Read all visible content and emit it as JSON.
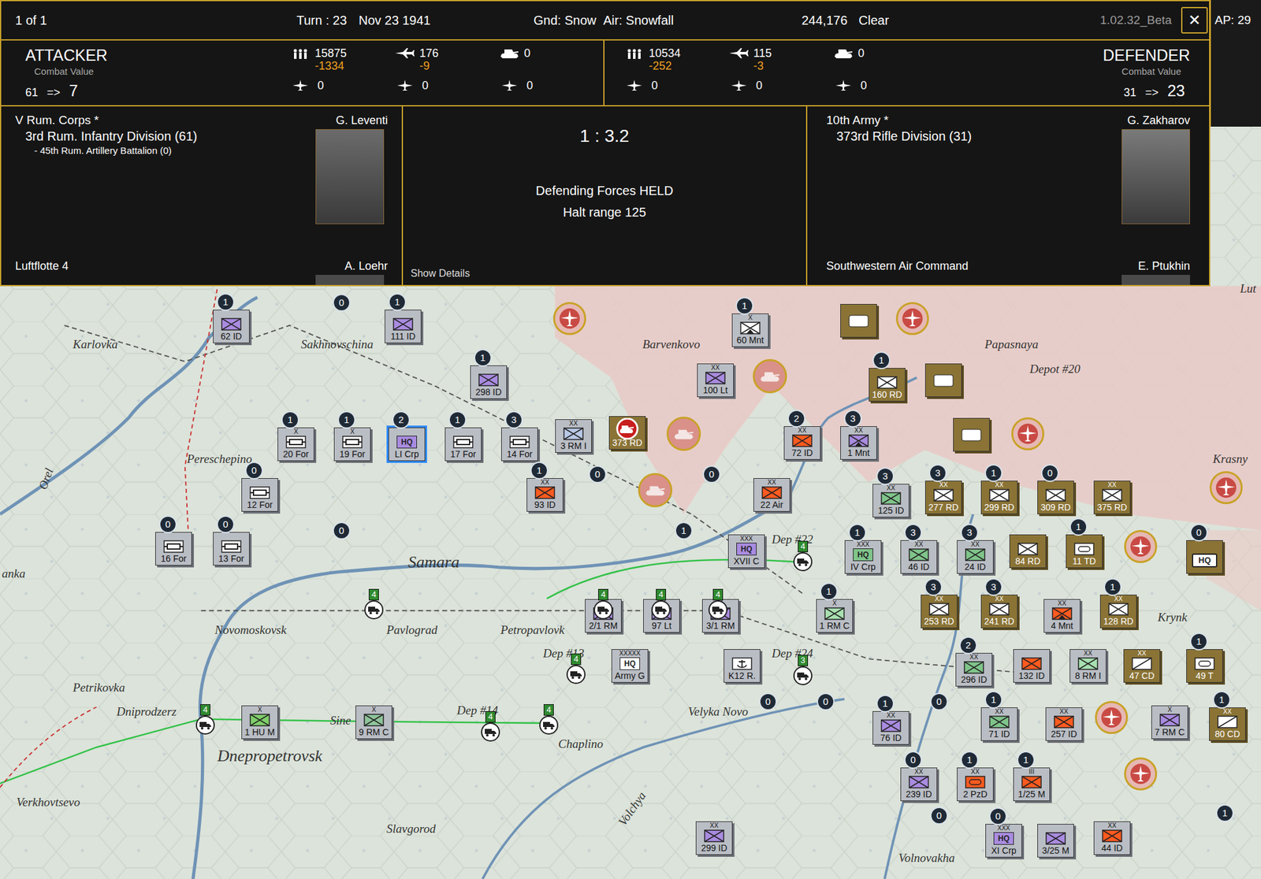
{
  "topbar": {
    "page": "1 of 1",
    "turn": "Turn : 23",
    "date": "Nov 23 1941",
    "ground": "Gnd: Snow",
    "air": "Air: Snowfall",
    "score": "244,176",
    "weather": "Clear",
    "version": "1.02.32_Beta",
    "close": "✕",
    "ap": "AP: 29"
  },
  "attacker": {
    "title": "ATTACKER",
    "cv_label": "Combat Value",
    "cv_from": "61",
    "arrow": "=>",
    "cv_to": "7",
    "men": "15875",
    "men_loss": "-1334",
    "planes": "176",
    "planes_loss": "-9",
    "tanks": "0",
    "row2": [
      "0",
      "0",
      "0"
    ],
    "hq": "V Rum. Corps *",
    "leader": "G. Leventi",
    "units": [
      {
        "text": "3rd Rum. Infantry Division (61)"
      },
      {
        "text": "- 45th Rum. Artillery Battalion (0)"
      }
    ],
    "air_hq": "Luftflotte 4",
    "air_leader": "A. Loehr"
  },
  "defender": {
    "title": "DEFENDER",
    "cv_label": "Combat Value",
    "cv_from": "31",
    "arrow": "=>",
    "cv_to": "23",
    "men": "10534",
    "men_loss": "-252",
    "planes": "115",
    "planes_loss": "-3",
    "tanks": "0",
    "row2": [
      "0",
      "0",
      "0"
    ],
    "hq": "10th Army *",
    "leader": "G. Zakharov",
    "units": [
      {
        "text": "373rd Rifle Division (31)"
      }
    ],
    "air_hq": "Southwestern Air Command",
    "air_leader": "E. Ptukhin"
  },
  "result": {
    "odds": "1 : 3.2",
    "outcome": "Defending Forces HELD",
    "halt": "Halt range 125",
    "details": "Show Details"
  },
  "map": {
    "labels": [
      {
        "text": "Karlovka"
      },
      {
        "text": "Sakhnovschina"
      },
      {
        "text": "Barvenkovo"
      },
      {
        "text": "Papasnaya"
      },
      {
        "text": "Depot #20"
      },
      {
        "text": "Krasny"
      },
      {
        "text": "Pereschepino"
      },
      {
        "text": "Samara"
      },
      {
        "text": "Novomoskovsk"
      },
      {
        "text": "Pavlograd"
      },
      {
        "text": "Petropavlovk"
      },
      {
        "text": "Petrikovka"
      },
      {
        "text": "Dniprodzerz"
      },
      {
        "text": "Dnepropetrovsk"
      },
      {
        "text": "Verkhovtsevo"
      },
      {
        "text": "Slavgorod"
      },
      {
        "text": "Chaplino"
      },
      {
        "text": "Velyka Novo"
      },
      {
        "text": "Volnovakha"
      },
      {
        "text": "Orel"
      },
      {
        "text": "Volchya"
      },
      {
        "text": "Sine"
      },
      {
        "text": "anka"
      },
      {
        "text": "Krynk"
      },
      {
        "text": "Lut"
      }
    ],
    "units": [
      {
        "label": "62 ID",
        "badge": "1",
        "side": "axis",
        "kind": "inf",
        "color": "#a98be0",
        "selected": false
      },
      {
        "label": "111 ID",
        "badge": "1",
        "side": "axis",
        "kind": "inf",
        "color": "#a98be0",
        "selected": false
      },
      {
        "label": "298 ID",
        "badge": "1",
        "side": "axis",
        "kind": "inf",
        "color": "#a98be0",
        "selected": false
      },
      {
        "label": "20 For",
        "badge": "1",
        "size": "X",
        "side": "axis",
        "kind": "fort",
        "color": "#ffffff",
        "selected": false
      },
      {
        "label": "19 For",
        "badge": "1",
        "size": "X",
        "side": "axis",
        "kind": "fort",
        "color": "#ffffff",
        "selected": false
      },
      {
        "label": "LI Crp",
        "badge": "2",
        "side": "axis",
        "kind": "hq",
        "symbol": "HQ",
        "color": "#a98be0",
        "selected": true
      },
      {
        "label": "17 For",
        "badge": "1",
        "side": "axis",
        "kind": "fort",
        "color": "#ffffff",
        "selected": false
      },
      {
        "label": "14 For",
        "badge": "3",
        "side": "axis",
        "kind": "fort",
        "color": "#ffffff",
        "selected": false
      },
      {
        "label": "3 RM I",
        "size": "XX",
        "side": "axis",
        "kind": "inf",
        "color": "#b8c8e6",
        "selected": false
      },
      {
        "label": "373 RD",
        "side": "soviet",
        "kind": "target",
        "color": "#d42a2a",
        "selected": false
      },
      {
        "label": "12 For",
        "badge": "0",
        "side": "axis",
        "kind": "fort",
        "color": "#ffffff",
        "selected": false
      },
      {
        "label": "93 ID",
        "badge": "1",
        "size": "XX",
        "side": "axis",
        "kind": "inf",
        "color": "#ff5a1f",
        "selected": false
      },
      {
        "label": "16 For",
        "badge": "0",
        "side": "axis",
        "kind": "fort",
        "color": "#ffffff",
        "selected": false
      },
      {
        "label": "13 For",
        "badge": "0",
        "side": "axis",
        "kind": "fort",
        "color": "#ffffff",
        "selected": false
      },
      {
        "label": "100 Lt",
        "size": "XX",
        "side": "axis",
        "kind": "inf",
        "color": "#a98be0",
        "selected": false
      },
      {
        "label": "60 Mnt",
        "badge": "1",
        "size": "X",
        "side": "axis",
        "kind": "mnt",
        "color": "#ffffff",
        "selected": false
      },
      {
        "label": "72 ID",
        "badge": "2",
        "size": "XX",
        "side": "axis",
        "kind": "inf",
        "color": "#ff5a1f",
        "selected": false
      },
      {
        "label": "1 Mnt",
        "badge": "3",
        "size": "XX",
        "side": "axis",
        "kind": "mnt",
        "color": "#a98be0",
        "selected": false
      },
      {
        "label": "22 Air",
        "size": "XX",
        "side": "axis",
        "kind": "inf",
        "color": "#ff5a1f",
        "selected": false
      },
      {
        "label": "XVII C",
        "size": "XXX",
        "side": "axis",
        "kind": "hq",
        "symbol": "HQ",
        "color": "#a98be0",
        "selected": false
      },
      {
        "label": "2/1 RM",
        "size": "X",
        "side": "axis",
        "kind": "inf",
        "color": "#a98be0",
        "selected": false
      },
      {
        "label": "97 Lt",
        "size": "XX",
        "side": "axis",
        "kind": "inf",
        "color": "#a98be0",
        "selected": false
      },
      {
        "label": "3/1 RM",
        "size": "X",
        "side": "axis",
        "kind": "inf",
        "color": "#a98be0",
        "selected": false
      },
      {
        "label": "1 RM C",
        "badge": "1",
        "size": "X",
        "side": "axis",
        "kind": "inf",
        "color": "#a8e0b0",
        "selected": false
      },
      {
        "label": "Army G",
        "size": "XXXXX",
        "side": "axis",
        "kind": "hq",
        "symbol": "HQ",
        "color": "#ffffff",
        "selected": false
      },
      {
        "label": "K12 R.",
        "side": "axis",
        "kind": "naval",
        "color": "#ffffff",
        "selected": false
      },
      {
        "label": "1 HU M",
        "size": "X",
        "side": "axis",
        "kind": "inf",
        "color": "#7fce6a",
        "selected": false
      },
      {
        "label": "9 RM C",
        "size": "X",
        "side": "axis",
        "kind": "inf",
        "color": "#8fc49a",
        "selected": false
      },
      {
        "label": "299 ID",
        "size": "XX",
        "side": "axis",
        "kind": "inf",
        "color": "#a98be0",
        "selected": false
      },
      {
        "label": "125 ID",
        "badge": "3",
        "size": "XX",
        "side": "axis",
        "kind": "inf",
        "color": "#7fc48a",
        "selected": false
      },
      {
        "label": "IV Crp",
        "badge": "1",
        "size": "XXX",
        "side": "axis",
        "kind": "hq",
        "symbol": "HQ",
        "color": "#7fc48a",
        "selected": false
      },
      {
        "label": "46 ID",
        "badge": "3",
        "size": "XX",
        "side": "axis",
        "kind": "inf",
        "color": "#7fc48a",
        "selected": false
      },
      {
        "label": "24 ID",
        "badge": "3",
        "size": "XX",
        "side": "axis",
        "kind": "inf",
        "color": "#7fc48a",
        "selected": false
      },
      {
        "label": "296 ID",
        "badge": "2",
        "size": "XX",
        "side": "axis",
        "kind": "inf",
        "color": "#7fc48a",
        "selected": false
      },
      {
        "label": "71 ID",
        "badge": "1",
        "size": "XX",
        "side": "axis",
        "kind": "inf",
        "color": "#7fc48a",
        "selected": false
      },
      {
        "label": "76 ID",
        "badge": "1",
        "size": "XX",
        "side": "axis",
        "kind": "inf",
        "color": "#a98be0",
        "selected": false
      },
      {
        "label": "239 ID",
        "badge": "0",
        "size": "XX",
        "side": "axis",
        "kind": "inf",
        "color": "#a98be0",
        "selected": false
      },
      {
        "label": "2 PzD",
        "badge": "1",
        "size": "XX",
        "side": "axis",
        "kind": "armor",
        "color": "#ff5a1f",
        "selected": false
      },
      {
        "label": "1/25 M",
        "badge": "1",
        "size": "III",
        "side": "axis",
        "kind": "inf",
        "color": "#ff5a1f",
        "selected": false
      },
      {
        "label": "XI Crp",
        "badge": "0",
        "size": "XXX",
        "side": "axis",
        "kind": "hq",
        "symbol": "HQ",
        "color": "#a98be0",
        "selected": false
      },
      {
        "label": "3/25 M",
        "side": "axis",
        "kind": "inf",
        "color": "#a98be0",
        "selected": false
      },
      {
        "label": "44 ID",
        "size": "XX",
        "side": "axis",
        "kind": "inf",
        "color": "#ff5a1f",
        "selected": false
      },
      {
        "label": "132 ID",
        "side": "axis",
        "kind": "inf",
        "color": "#ff5a1f",
        "selected": false
      },
      {
        "label": "8 RM I",
        "size": "XX",
        "side": "axis",
        "kind": "inf",
        "color": "#a8e0b0",
        "selected": false
      },
      {
        "label": "257 ID",
        "size": "XX",
        "side": "axis",
        "kind": "inf",
        "color": "#ff5a1f",
        "selected": false
      },
      {
        "label": "7 RM C",
        "size": "X",
        "side": "axis",
        "kind": "inf",
        "color": "#a98be0",
        "selected": false
      },
      {
        "label": "4 Mnt",
        "size": "XX",
        "side": "axis",
        "kind": "mnt",
        "color": "#ff5a1f",
        "selected": false
      },
      {
        "label": "160 RD",
        "badge": "1",
        "side": "soviet",
        "kind": "inf",
        "color": "#ffffff",
        "selected": false
      },
      {
        "label": "277 RD",
        "badge": "3",
        "size": "XX",
        "side": "soviet",
        "kind": "inf",
        "color": "#ffffff",
        "selected": false
      },
      {
        "label": "299 RD",
        "badge": "1",
        "size": "XX",
        "side": "soviet",
        "kind": "inf",
        "color": "#ffffff",
        "selected": false
      },
      {
        "label": "309 RD",
        "badge": "0",
        "side": "soviet",
        "kind": "inf",
        "color": "#ffffff",
        "selected": false
      },
      {
        "label": "375 RD",
        "size": "XX",
        "side": "soviet",
        "kind": "inf",
        "color": "#ffffff",
        "selected": false
      },
      {
        "label": "84 RD",
        "side": "soviet",
        "kind": "inf",
        "color": "#ffffff",
        "selected": false
      },
      {
        "label": "11 TD",
        "badge": "1",
        "side": "soviet",
        "kind": "armor",
        "color": "#ffffff",
        "selected": false
      },
      {
        "label": "253 RD",
        "badge": "3",
        "size": "XX",
        "side": "soviet",
        "kind": "inf",
        "color": "#ffffff",
        "selected": false
      },
      {
        "label": "241 RD",
        "badge": "3",
        "size": "XX",
        "side": "soviet",
        "kind": "inf",
        "color": "#ffffff",
        "selected": false
      },
      {
        "label": "128 RD",
        "badge": "1",
        "size": "XX",
        "side": "soviet",
        "kind": "inf",
        "color": "#ffffff",
        "selected": false
      },
      {
        "label": "47 CD",
        "size": "XX",
        "side": "soviet",
        "kind": "cav",
        "color": "#ffffff",
        "selected": false
      },
      {
        "label": "49 T",
        "badge": "1",
        "side": "soviet",
        "kind": "armor",
        "color": "#ffffff",
        "selected": false
      },
      {
        "label": "80 CD",
        "badge": "1",
        "size": "XX",
        "side": "soviet",
        "kind": "cav",
        "color": "#ffffff",
        "selected": false
      },
      {
        "label": "HQ",
        "badge": "0",
        "side": "soviet",
        "kind": "hq-only",
        "color": "#ffffff",
        "selected": false
      }
    ],
    "markers": [
      {
        "text": "0"
      },
      {
        "text": "0"
      },
      {
        "text": "0"
      },
      {
        "text": "0"
      },
      {
        "text": "1"
      },
      {
        "text": "0"
      },
      {
        "text": "0"
      },
      {
        "text": "0"
      },
      {
        "text": "0"
      },
      {
        "text": "1"
      }
    ],
    "depots": [
      {
        "name": "Dep #13",
        "level": "4"
      },
      {
        "name": "Dep #14",
        "level": "4"
      },
      {
        "name": "Dep #22",
        "level": "4"
      },
      {
        "name": "Dep #24",
        "level": "3"
      }
    ],
    "supply": [
      {
        "level": "4"
      },
      {
        "level": "4"
      },
      {
        "level": "4"
      },
      {
        "level": "4"
      },
      {
        "level": "4"
      },
      {
        "level": "4"
      }
    ]
  }
}
